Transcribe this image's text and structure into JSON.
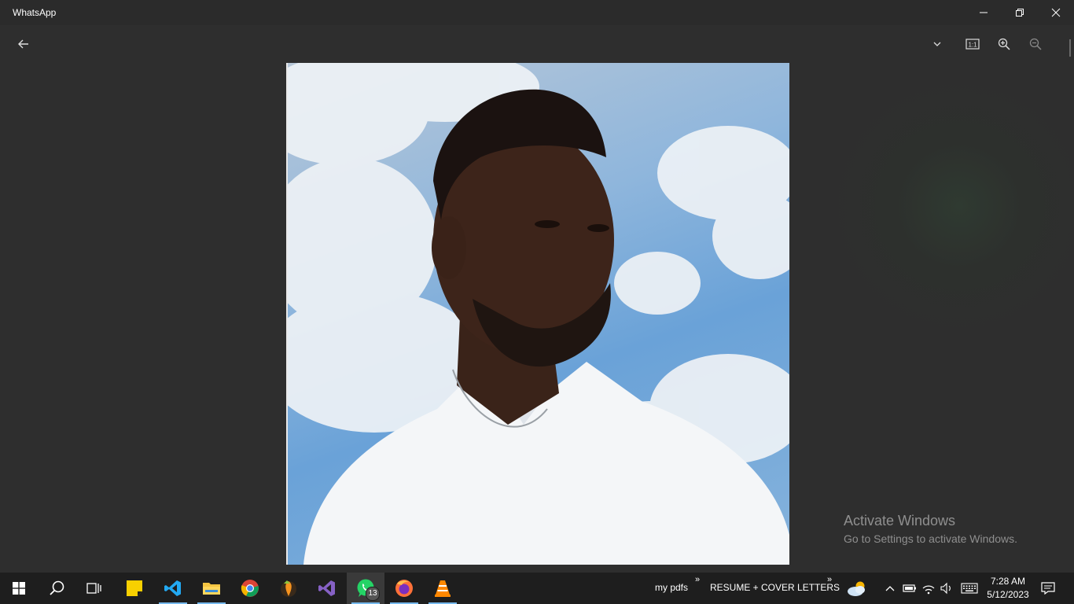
{
  "window": {
    "title": "WhatsApp"
  },
  "watermark": {
    "line1": "Activate Windows",
    "line2": "Go to Settings to activate Windows."
  },
  "viewer_toolbar": {
    "actual_size_label": "1:1"
  },
  "taskbar": {
    "whatsapp_badge": "13",
    "folder1": "my pdfs",
    "folder2": "RESUME + COVER LETTERS",
    "time": "7:28 AM",
    "date": "5/12/2023"
  },
  "colors": {
    "accent": "#76b9ed",
    "whatsapp": "#25d366"
  }
}
